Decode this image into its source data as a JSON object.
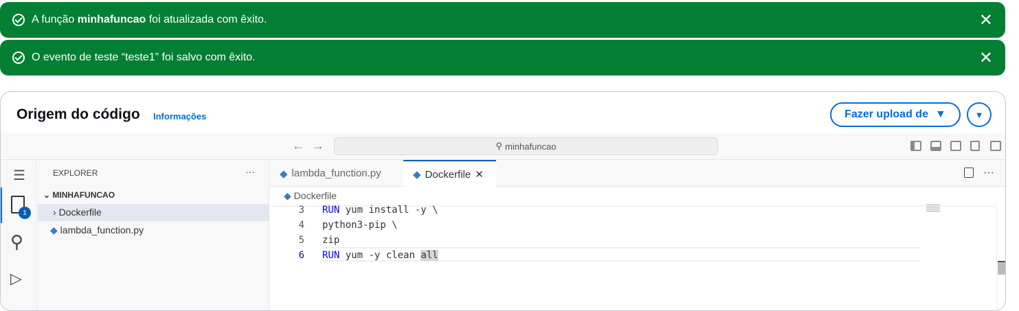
{
  "notifications": [
    {
      "prefix": "A função ",
      "bold": "minhafuncao",
      "suffix": " foi atualizada com êxito."
    },
    {
      "text": "O evento de teste “teste1” foi salvo com êxito."
    }
  ],
  "header": {
    "title": "Origem do código",
    "info": "Informações",
    "upload": "Fazer upload de"
  },
  "toolbar": {
    "search": "minhafuncao"
  },
  "explorer": {
    "title": "EXPLORER",
    "more": "···",
    "folder": "MINHAFUNCAO",
    "files": [
      "Dockerfile",
      "lambda_function.py"
    ],
    "badge": "1"
  },
  "tabs": [
    "lambda_function.py",
    "Dockerfile"
  ],
  "breadcrumb": "Dockerfile",
  "code": [
    {
      "n": "3",
      "kw": "RUN",
      "rest": " yum install -y \\"
    },
    {
      "n": "4",
      "kw": "",
      "rest": "python3-pip \\"
    },
    {
      "n": "5",
      "kw": "",
      "rest": "zip"
    },
    {
      "n": "6",
      "kw": "RUN",
      "rest": " yum -y clean ",
      "hl": "all"
    }
  ],
  "colors": {
    "success": "#037f33",
    "accent": "#006ce0"
  }
}
